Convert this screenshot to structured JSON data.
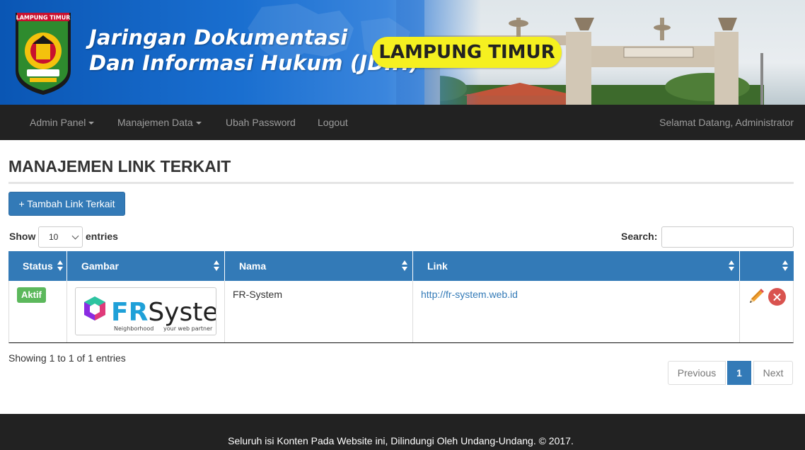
{
  "header": {
    "title_line1": "Jaringan Dokumentasi",
    "title_line2": "Dan Informasi Hukum (JDIH)",
    "region": "LAMPUNG TIMUR",
    "logo_caption": "LAMPUNG TIMUR",
    "logo_icon": "regency-crest-icon"
  },
  "nav": {
    "items": [
      {
        "label": "Admin Panel",
        "dropdown": true
      },
      {
        "label": "Manajemen Data",
        "dropdown": true
      },
      {
        "label": "Ubah Password",
        "dropdown": false
      },
      {
        "label": "Logout",
        "dropdown": false
      }
    ],
    "welcome": "Selamat Datang, Administrator"
  },
  "main": {
    "page_title": "MANAJEMEN LINK TERKAIT",
    "add_button": "+ Tambah Link Terkait",
    "show_label": "Show",
    "entries_value": "10",
    "entries_label": "entries",
    "search_label": "Search:",
    "search_value": ""
  },
  "table": {
    "columns": [
      "Status",
      "Gambar",
      "Nama",
      "Link",
      ""
    ],
    "rows": [
      {
        "status": "Aktif",
        "image_text": "FRSystem",
        "image_sub_left": "Neighborhood",
        "image_sub_right": "your web partner",
        "name": "FR-System",
        "link": "http://fr-system.web.id",
        "actions": [
          "pencil-icon",
          "close-icon"
        ]
      }
    ]
  },
  "pagination": {
    "info": "Showing 1 to 1 of 1 entries",
    "prev": "Previous",
    "current": "1",
    "next": "Next"
  },
  "footer": {
    "text": "Seluruh isi Konten Pada Website ini, Dilindungi Oleh Undang-Undang. © 2017."
  },
  "colors": {
    "primary": "#337ab7",
    "navbar": "#222222",
    "success": "#5cb85c",
    "danger": "#d9534f",
    "region_pill": "#f5f020"
  }
}
